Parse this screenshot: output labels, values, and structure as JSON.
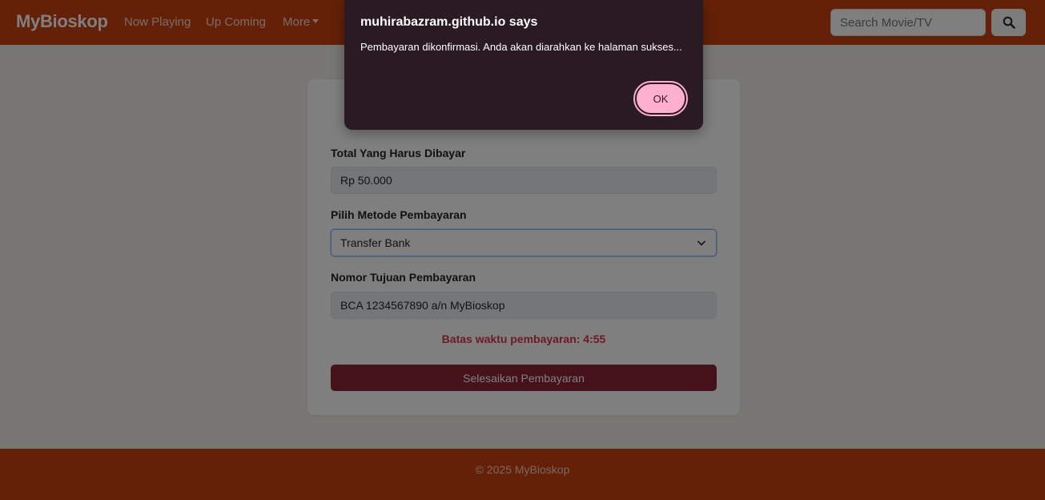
{
  "navbar": {
    "brand": "MyBioskop",
    "links": [
      "Now Playing",
      "Up Coming"
    ],
    "more_label": "More",
    "search_placeholder": "Search Movie/TV",
    "search_icon": "search-icon"
  },
  "form": {
    "total_label": "Total Yang Harus Dibayar",
    "total_value": "Rp 50.000",
    "method_label": "Pilih Metode Pembayaran",
    "method_value": "Transfer Bank",
    "dest_label": "Nomor Tujuan Pembayaran",
    "dest_value": "BCA 1234567890 a/n MyBioskop",
    "timer_text": "Batas waktu pembayaran: 4:55",
    "submit_label": "Selesaikan Pembayaran"
  },
  "footer": {
    "text": "© 2025 MyBioskop"
  },
  "dialog": {
    "title": "muhirabazram.github.io says",
    "message": "Pembayaran dikonfirmasi. Anda akan diarahkan ke halaman sukses...",
    "ok_label": "OK"
  },
  "colors": {
    "brand": "#c8420f",
    "submit": "#8b2335",
    "timer": "#dc3545",
    "dialog_bg": "#2a1a21",
    "ok_bg": "#ffb0d0"
  }
}
